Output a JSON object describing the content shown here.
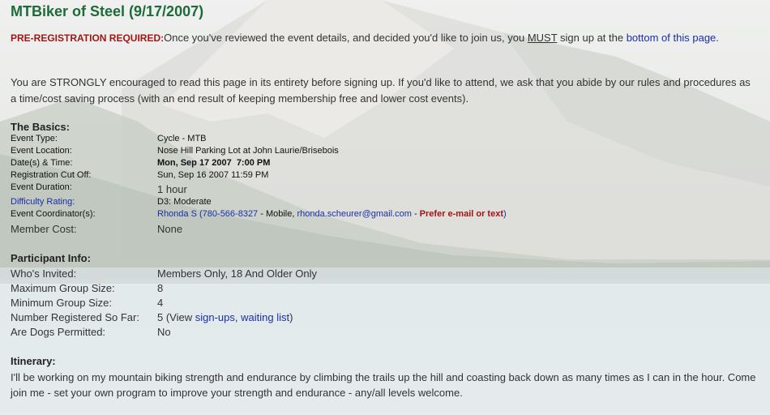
{
  "title": "MTBiker of Steel (9/17/2007)",
  "prereg": {
    "label": "PRE-REGISTRATION REQUIRED:",
    "text_before_must": "Once you've reviewed the event details, and decided you'd like to join us, you ",
    "must": "MUST",
    "text_after_must": " sign up at the ",
    "link": "bottom of this page",
    "end": "."
  },
  "notice": "You are STRONGLY encouraged to read this page in its entirety before signing up. If you'd like to attend, we ask that you abide by our rules and procedures as a time/cost saving process (with an end result of keeping membership free and lower cost events).",
  "basics": {
    "heading": "The Basics:",
    "event_type_label": "Event Type:",
    "event_type": "Cycle - MTB",
    "location_label": "Event Location:",
    "location": "Nose Hill Parking Lot at John Laurie/Brisebois",
    "dates_label": "Date(s) & Time:",
    "dates": "Mon, Sep 17 2007  7:00 PM",
    "cutoff_label": "Registration Cut Off:",
    "cutoff": "Sun, Sep 16 2007 11:59 PM",
    "duration_label": "Event Duration:",
    "duration": "1 hour",
    "difficulty_label": "Difficulty Rating:",
    "difficulty": "D3: Moderate",
    "coordinator_label": "Event Coordinator(s):",
    "coordinator_name": "Rhonda S",
    "coordinator_open": " (",
    "coordinator_phone": "780-566-8327",
    "coordinator_mobile": " - Mobile, ",
    "coordinator_email": "rhonda.scheurer@gmail.com",
    "coordinator_dash": " - ",
    "coordinator_pref": "Prefer e-mail or text",
    "coordinator_close": ")",
    "cost_label": "Member Cost:",
    "cost": "None"
  },
  "participant": {
    "heading": "Participant Info:",
    "invited_label": "Who's Invited:",
    "invited": "Members Only, 18 And Older Only",
    "max_label": "Maximum Group Size:",
    "max": "8",
    "min_label": "Minimum Group Size:",
    "min": "4",
    "registered_label": "Number Registered So Far:",
    "registered_prefix": "5 (View ",
    "signups_link": "sign-ups",
    "comma": ", ",
    "waiting_link": "waiting list",
    "registered_suffix": ")",
    "dogs_label": "Are Dogs Permitted:",
    "dogs": "No"
  },
  "itinerary": {
    "heading": "Itinerary:",
    "text": "I'll be working on my mountain biking strength and endurance by climbing the trails up the hill and coasting back down as many times as I can in the hour. Come join me - set your own program to improve your strength and endurance - any/all levels welcome."
  }
}
